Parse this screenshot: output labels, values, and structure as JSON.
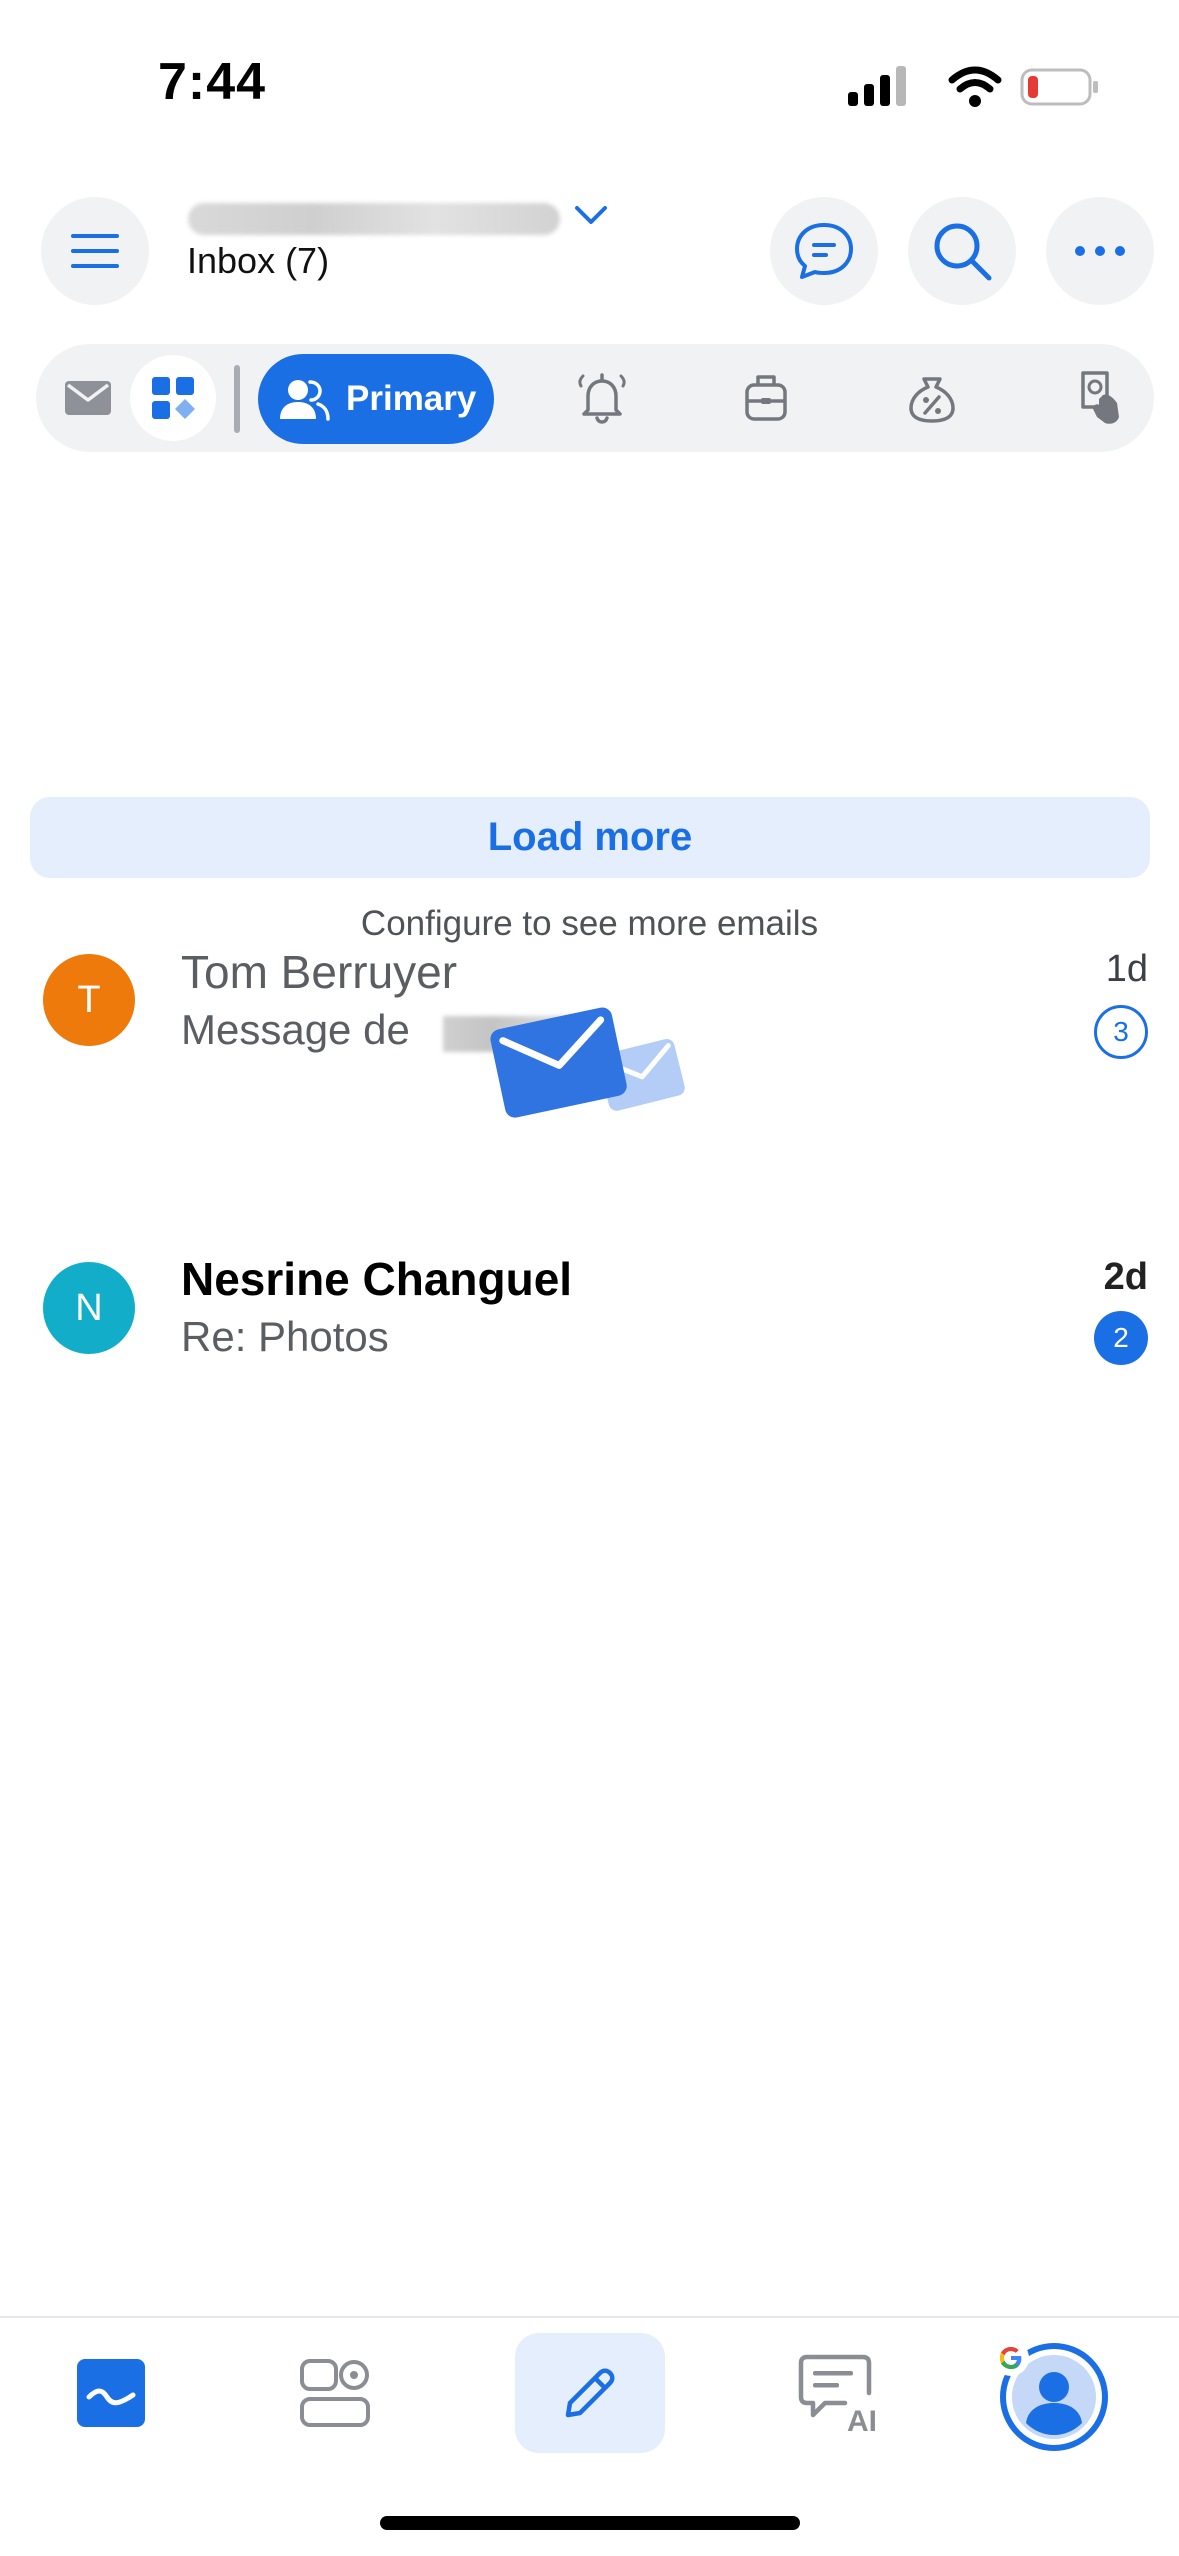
{
  "status_bar": {
    "time": "7:44"
  },
  "header": {
    "inbox_label": "Inbox (7)"
  },
  "tabs": {
    "primary_label": "Primary"
  },
  "messages": [
    {
      "avatar_letter": "T",
      "avatar_color": "#ee7a0c",
      "sender": "Tom Berruyer",
      "subject": "Message de",
      "date": "1d",
      "count": "3",
      "unread": false
    },
    {
      "avatar_letter": "N",
      "avatar_color": "#12aec9",
      "sender": "Nesrine Changuel",
      "subject": "Re: Photos",
      "date": "2d",
      "count": "2",
      "unread": true
    }
  ],
  "load_more_label": "Load more",
  "configure_text": "Configure to see more emails",
  "bottom_nav": {
    "ai_label": "AI"
  },
  "colors": {
    "accent": "#1a6fe5",
    "accent_light": "#e4eefc",
    "chip_bg": "#f1f2f4"
  },
  "icons": [
    "menu-icon",
    "chat-icon",
    "search-icon",
    "more-icon",
    "mail-icon",
    "all-categories-icon",
    "person-icon",
    "bell-icon",
    "luggage-icon",
    "discount-icon",
    "receipt-icon",
    "inbox-icon",
    "widgets-icon",
    "compose-icon",
    "ai-chat-icon",
    "account-icon"
  ]
}
